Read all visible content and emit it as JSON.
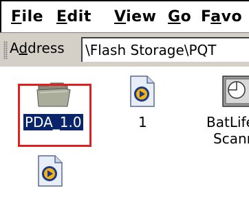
{
  "menu": {
    "file": {
      "acc": "F",
      "rest": "ile"
    },
    "edit": {
      "acc": "E",
      "rest": "dit"
    },
    "view": {
      "acc": "V",
      "rest": "iew"
    },
    "go": {
      "acc": "G",
      "rest": "o"
    },
    "favorites": {
      "pre": "F",
      "acc": "a",
      "rest": "vo"
    }
  },
  "address": {
    "label_pre": "A",
    "label_acc": "d",
    "label_rest": "dress",
    "path": "\\Flash Storage\\PQT"
  },
  "items": [
    {
      "label": "PDA_1.0",
      "icon": "folder-icon",
      "selected": true
    },
    {
      "label": "1",
      "icon": "media-file-icon"
    },
    {
      "label_line1": "BatLife",
      "label_line2": "Scann",
      "icon": "application-icon"
    },
    {
      "icon": "media-file-icon"
    }
  ],
  "colors": {
    "selection": "#0a246a",
    "highlight_box": "#e02020",
    "toolbar": "#d4d0c8"
  }
}
